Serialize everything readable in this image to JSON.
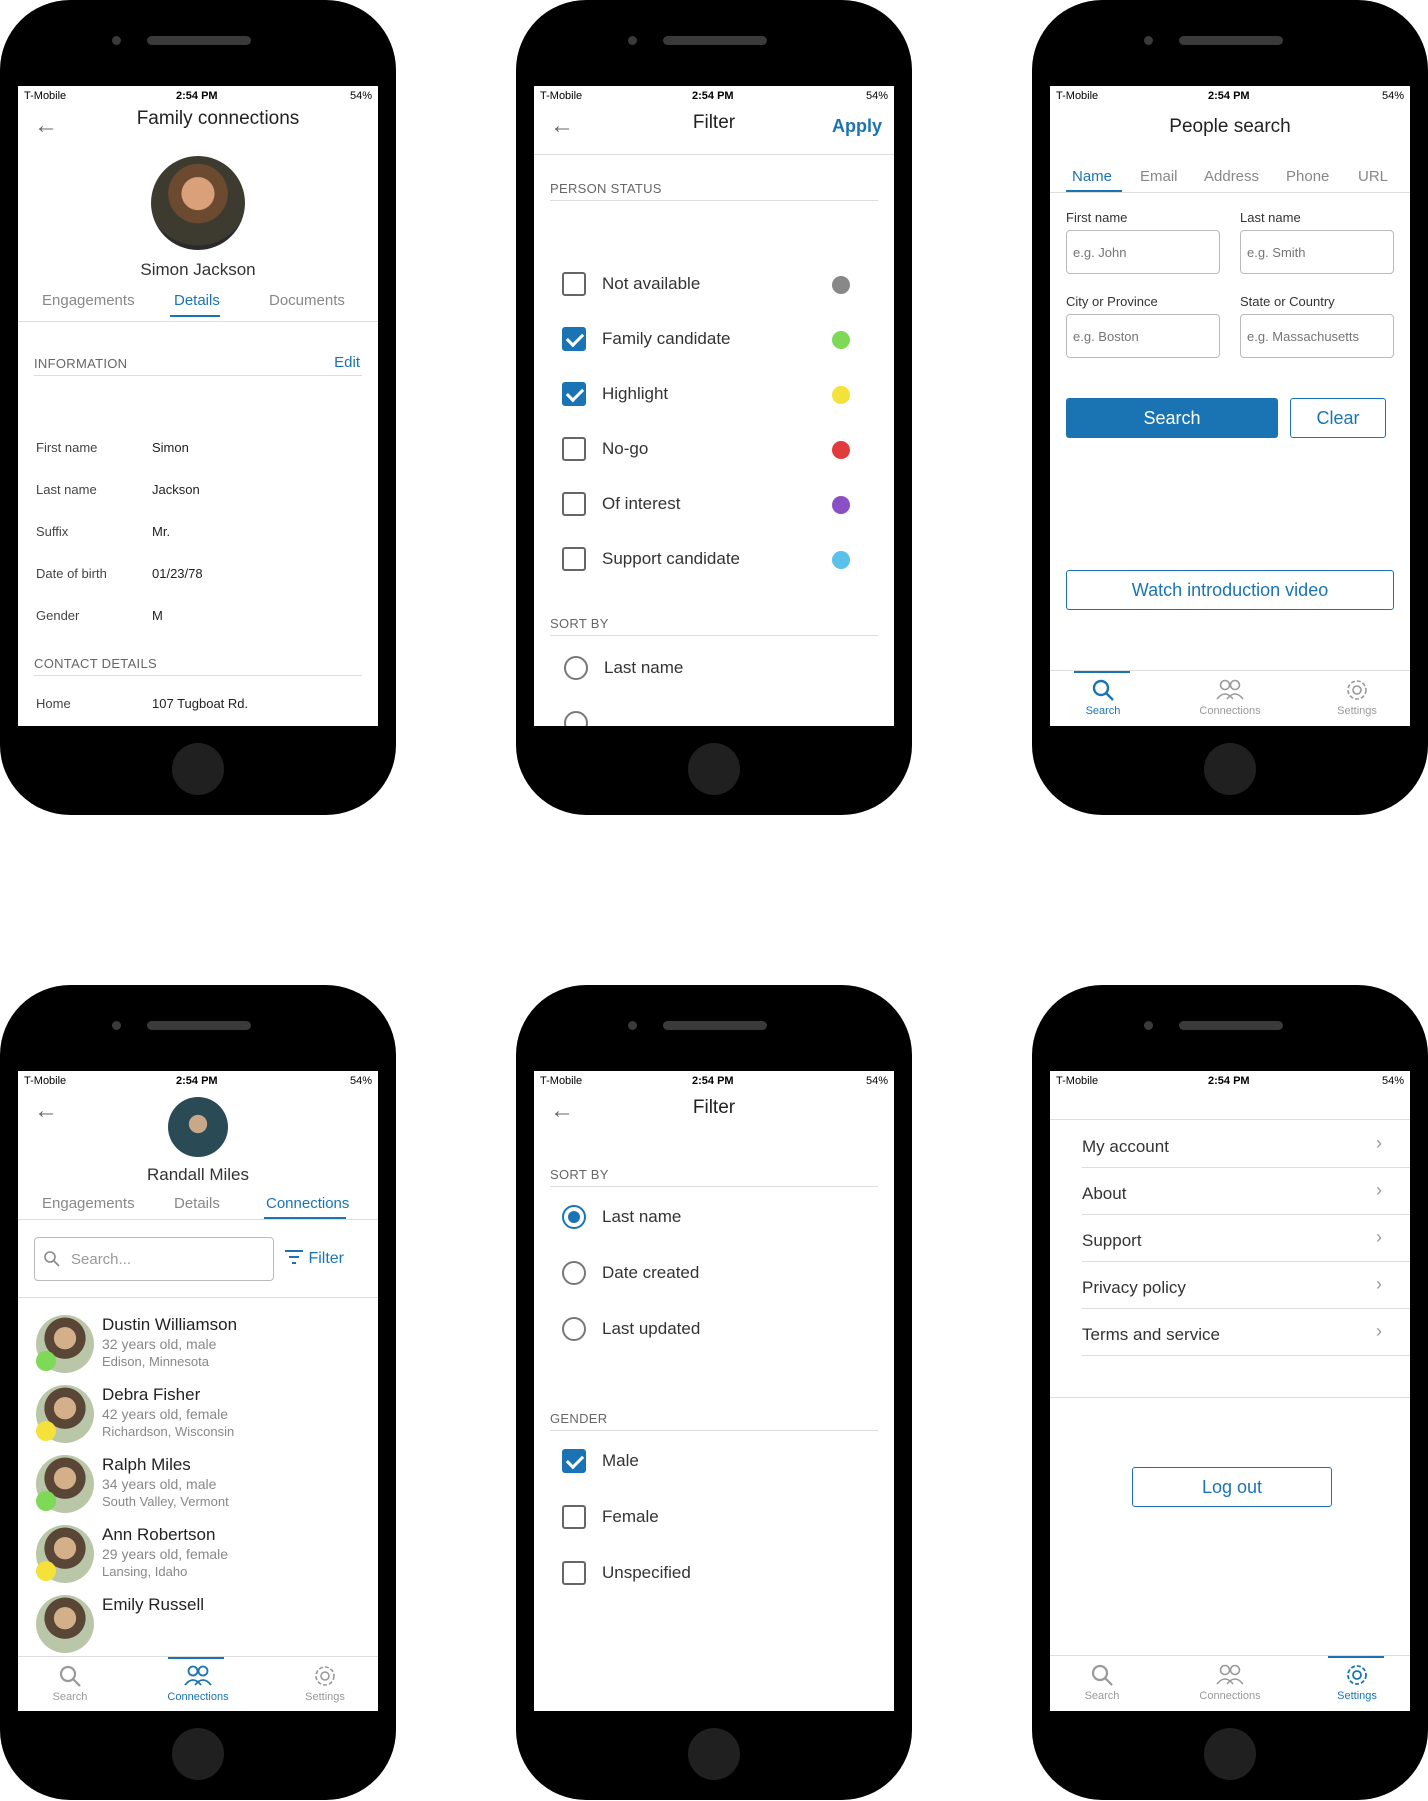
{
  "status_bar": {
    "carrier": "T-Mobile",
    "time": "2:54 PM",
    "battery": "54%"
  },
  "icons": {
    "back": "arrow-left-icon",
    "search": "search-icon",
    "connections": "people-icon",
    "settings": "gear-icon",
    "chevron": "chevron-right-icon",
    "filter": "filter-icon"
  },
  "colors": {
    "accent": "#1a74b4",
    "gray": "#888888",
    "green": "#7ed957",
    "yellow": "#f4e13a",
    "red": "#e23b3b",
    "purple": "#8a4fc4",
    "blue": "#5bc0eb"
  },
  "nav": {
    "search": "Search",
    "connections": "Connections",
    "settings": "Settings"
  },
  "details": {
    "title": "Family connections",
    "person_name": "Simon Jackson",
    "tabs": [
      "Engagements",
      "Details",
      "Documents"
    ],
    "info_header": "INFORMATION",
    "edit": "Edit",
    "fields": [
      {
        "label": "First name",
        "value": "Simon"
      },
      {
        "label": "Last name",
        "value": "Jackson"
      },
      {
        "label": "Suffix",
        "value": "Mr."
      },
      {
        "label": "Date of birth",
        "value": "01/23/78"
      },
      {
        "label": "Gender",
        "value": "M"
      }
    ],
    "contact_header": "CONTACT DETAILS",
    "contact": {
      "label": "Home",
      "value": "107 Tugboat Rd."
    }
  },
  "filter1": {
    "title": "Filter",
    "apply": "Apply",
    "status_header": "PERSON STATUS",
    "statuses": [
      {
        "label": "Not available",
        "checked": false,
        "color": "#888888"
      },
      {
        "label": "Family candidate",
        "checked": true,
        "color": "#7ed957"
      },
      {
        "label": "Highlight",
        "checked": true,
        "color": "#f4e13a"
      },
      {
        "label": "No-go",
        "checked": false,
        "color": "#e23b3b"
      },
      {
        "label": "Of interest",
        "checked": false,
        "color": "#8a4fc4"
      },
      {
        "label": "Support candidate",
        "checked": false,
        "color": "#5bc0eb"
      }
    ],
    "sort_header": "SORT BY",
    "sort_first": "Last name"
  },
  "search": {
    "title": "People search",
    "tabs": [
      "Name",
      "Email",
      "Address",
      "Phone",
      "URL"
    ],
    "first_name_label": "First name",
    "first_name_placeholder": "e.g. John",
    "last_name_label": "Last name",
    "last_name_placeholder": "e.g. Smith",
    "city_label": "City or Province",
    "city_placeholder": "e.g. Boston",
    "state_label": "State or Country",
    "state_placeholder": "e.g. Massachusetts",
    "search_button": "Search",
    "clear_button": "Clear",
    "video_button": "Watch introduction video"
  },
  "connections": {
    "person_name": "Randall Miles",
    "tabs": [
      "Engagements",
      "Details",
      "Connections"
    ],
    "search_placeholder": "Search...",
    "filter": "Filter",
    "people": [
      {
        "name": "Dustin Williamson",
        "info": "32 years old, male",
        "location": "Edison, Minnesota",
        "status": "#7ed957"
      },
      {
        "name": "Debra Fisher",
        "info": "42 years old, female",
        "location": "Richardson, Wisconsin",
        "status": "#f4e13a"
      },
      {
        "name": "Ralph Miles",
        "info": "34 years old, male",
        "location": "South Valley, Vermont",
        "status": "#7ed957"
      },
      {
        "name": "Ann Robertson",
        "info": "29 years old, female",
        "location": "Lansing, Idaho",
        "status": "#f4e13a"
      },
      {
        "name": "Emily Russell",
        "info": "",
        "location": "",
        "status": ""
      }
    ]
  },
  "filter2": {
    "title": "Filter",
    "sort_header": "SORT BY",
    "sorts": [
      {
        "label": "Last name",
        "selected": true
      },
      {
        "label": "Date created",
        "selected": false
      },
      {
        "label": "Last updated",
        "selected": false
      }
    ],
    "gender_header": "GENDER",
    "genders": [
      {
        "label": "Male",
        "checked": true
      },
      {
        "label": "Female",
        "checked": false
      },
      {
        "label": "Unspecified",
        "checked": false
      }
    ]
  },
  "settings": {
    "items": [
      "My account",
      "About",
      "Support",
      "Privacy policy",
      "Terms and service"
    ],
    "logout": "Log out"
  }
}
